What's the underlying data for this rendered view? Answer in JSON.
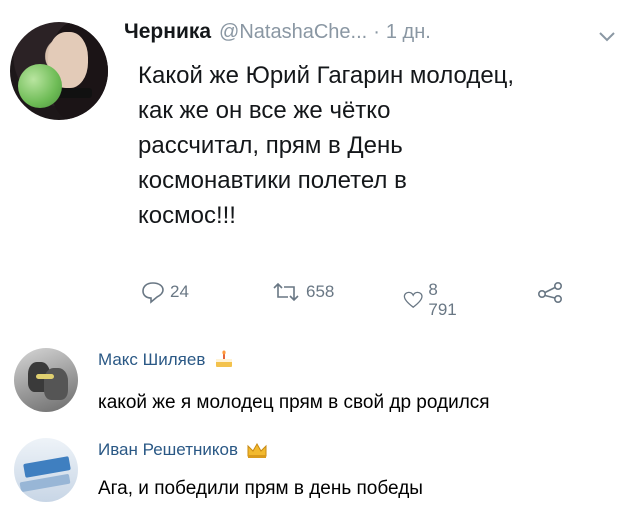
{
  "tweet": {
    "author_name": "Черника",
    "author_handle": "@NatashaChe...",
    "separator": "·",
    "time": "1 дн.",
    "text": "Какой же Юрий Гагарин молодец,\nкак же он все же чётко\nрассчитал, прям в День\nкосмонавтики полетел в\nкосмос!!!",
    "replies": "24",
    "retweets": "658",
    "likes": "8 791",
    "icons": {
      "reply": "reply-icon",
      "retweet": "retweet-icon",
      "like": "heart-icon",
      "share": "share-icon",
      "more": "chevron-down-icon"
    }
  },
  "comments": [
    {
      "author": "Макс Шиляев",
      "gift_icon": "cake-icon",
      "text": "какой же я молодец прям в свой др родился"
    },
    {
      "author": "Иван Решетников",
      "gift_icon": "crown-icon",
      "text": "Ага, и победили прям в день победы"
    }
  ],
  "colors": {
    "comment_author": "#2a5885",
    "meta_gray": "#8a97a3",
    "action_gray": "#697784"
  }
}
